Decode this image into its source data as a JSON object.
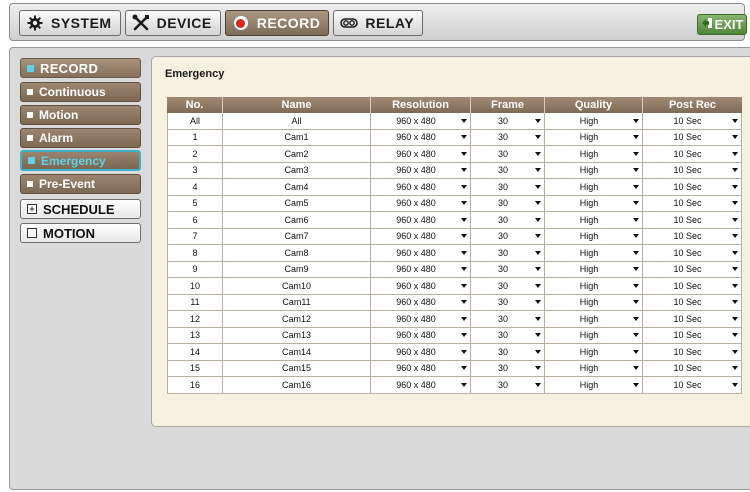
{
  "topbar": {
    "tabs": [
      {
        "label": "SYSTEM",
        "icon": "gear-icon"
      },
      {
        "label": "DEVICE",
        "icon": "tools-icon"
      },
      {
        "label": "RECORD",
        "icon": "record-icon"
      },
      {
        "label": "RELAY",
        "icon": "relay-icon"
      }
    ],
    "active_tab": "RECORD",
    "exit_label": "EXIT"
  },
  "sidebar": {
    "record": "RECORD",
    "items": [
      "Continuous",
      "Motion",
      "Alarm",
      "Emergency",
      "Pre-Event"
    ],
    "active_item": "Emergency",
    "schedule": "SCHEDULE",
    "motion": "MOTION"
  },
  "panel": {
    "title": "Emergency",
    "columns": [
      "No.",
      "Name",
      "Resolution",
      "Frame",
      "Quality",
      "Post Rec"
    ],
    "rows": [
      [
        "All",
        "All",
        "960 x 480",
        "30",
        "High",
        "10 Sec"
      ],
      [
        "1",
        "Cam1",
        "960 x 480",
        "30",
        "High",
        "10 Sec"
      ],
      [
        "2",
        "Cam2",
        "960 x 480",
        "30",
        "High",
        "10 Sec"
      ],
      [
        "3",
        "Cam3",
        "960 x 480",
        "30",
        "High",
        "10 Sec"
      ],
      [
        "4",
        "Cam4",
        "960 x 480",
        "30",
        "High",
        "10 Sec"
      ],
      [
        "5",
        "Cam5",
        "960 x 480",
        "30",
        "High",
        "10 Sec"
      ],
      [
        "6",
        "Cam6",
        "960 x 480",
        "30",
        "High",
        "10 Sec"
      ],
      [
        "7",
        "Cam7",
        "960 x 480",
        "30",
        "High",
        "10 Sec"
      ],
      [
        "8",
        "Cam8",
        "960 x 480",
        "30",
        "High",
        "10 Sec"
      ],
      [
        "9",
        "Cam9",
        "960 x 480",
        "30",
        "High",
        "10 Sec"
      ],
      [
        "10",
        "Cam10",
        "960 x 480",
        "30",
        "High",
        "10 Sec"
      ],
      [
        "11",
        "Cam11",
        "960 x 480",
        "30",
        "High",
        "10 Sec"
      ],
      [
        "12",
        "Cam12",
        "960 x 480",
        "30",
        "High",
        "10 Sec"
      ],
      [
        "13",
        "Cam13",
        "960 x 480",
        "30",
        "High",
        "10 Sec"
      ],
      [
        "14",
        "Cam14",
        "960 x 480",
        "30",
        "High",
        "10 Sec"
      ],
      [
        "15",
        "Cam15",
        "960 x 480",
        "30",
        "High",
        "10 Sec"
      ],
      [
        "16",
        "Cam16",
        "960 x 480",
        "30",
        "High",
        "10 Sec"
      ]
    ]
  },
  "colors": {
    "accent_brown": "#8f7a65",
    "active_cyan": "#5fd2e5",
    "panel_bg": "#f6f1e1",
    "exit_green": "#5f9a45",
    "record_red": "#d8261f"
  }
}
